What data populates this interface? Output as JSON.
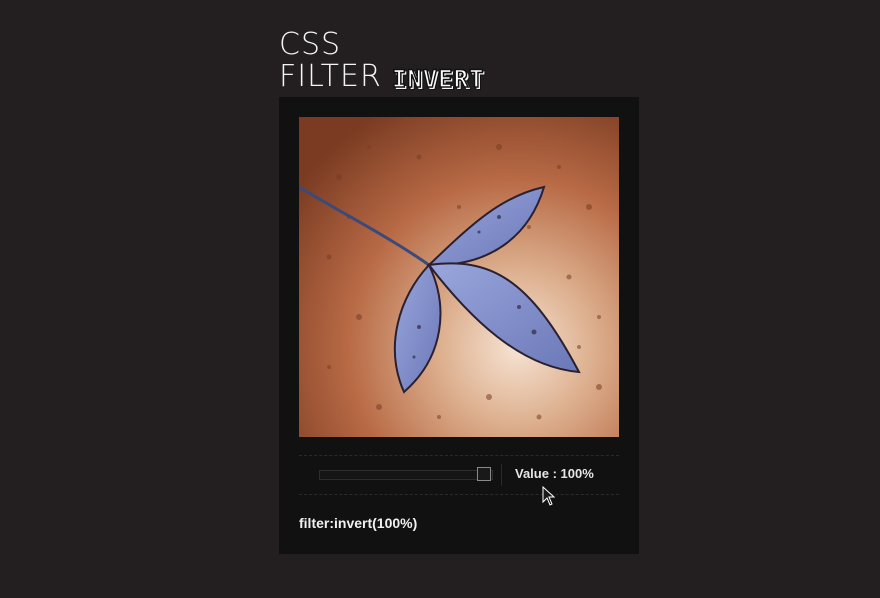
{
  "title": {
    "line1": "CSS",
    "line2_prefix": "FILTER",
    "line2_highlight": "INVERT"
  },
  "image": {
    "icon": "inverted-leaf-image",
    "background_color": "#b0603a",
    "leaf_color": "#7f8dcb"
  },
  "controls": {
    "slider_value_fraction": 1.0,
    "value_label": "Value : 100%"
  },
  "code": {
    "css": "filter:invert(100%)"
  },
  "cursor": {
    "icon": "mouse-pointer-icon"
  }
}
